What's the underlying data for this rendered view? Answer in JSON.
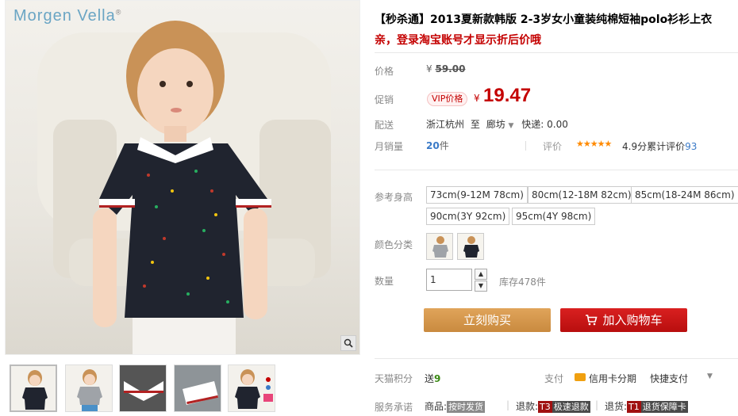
{
  "brand": {
    "name": "Morgen Vella",
    "mark": "®"
  },
  "product": {
    "title": "【秒杀通】2013夏新款韩版 2-3岁女小童装纯棉短袖polo衫衫上衣",
    "subtitle": "亲，登录淘宝账号才显示折后价哦"
  },
  "price": {
    "label": "价格",
    "currency": "¥",
    "original": "59.00",
    "promo_label": "促销",
    "vip_badge": "VIP价格",
    "promo_value": "19.47"
  },
  "shipping": {
    "label": "配送",
    "from": "浙江杭州",
    "to_word": "至",
    "destination": "廊坊",
    "express": "快递: 0.00"
  },
  "sales": {
    "label": "月销量",
    "count": "20",
    "unit": "件",
    "rating_label": "评价",
    "stars": "★★★★★",
    "score": "4.9分",
    "review_prefix": "累计评价",
    "review_count": "93"
  },
  "sizes": {
    "label": "参考身高",
    "options": [
      "73cm(9-12M 78cm)",
      "80cm(12-18M 82cm)",
      "85cm(18-24M 86cm)",
      "90cm(3Y 92cm)",
      "95cm(4Y 98cm)"
    ]
  },
  "colors": {
    "label": "颜色分类"
  },
  "quantity": {
    "label": "数量",
    "value": "1",
    "up": "▲",
    "down": "▼",
    "stock": "库存478件"
  },
  "actions": {
    "buy_now": "立刻购买",
    "add_to_cart": "加入购物车"
  },
  "points": {
    "label": "天猫积分",
    "prefix": "送",
    "value": "9"
  },
  "payment": {
    "label": "支付",
    "card": "信用卡分期",
    "quick": "快捷支付"
  },
  "service": {
    "label": "服务承诺",
    "goods_prefix": "商品:",
    "goods_tag": "按时发货",
    "refund_prefix": "退款:",
    "refund_tag1": "T3",
    "refund_tag2": "极速退款",
    "return_prefix": "退货:",
    "return_tag1": "T1",
    "return_tag2": "退货保障卡"
  },
  "colors_ui": {
    "accent_red": "#c40000",
    "buy_orange": "#d49b54",
    "cart_red": "#c41414",
    "link_blue": "#3a7ac7"
  }
}
